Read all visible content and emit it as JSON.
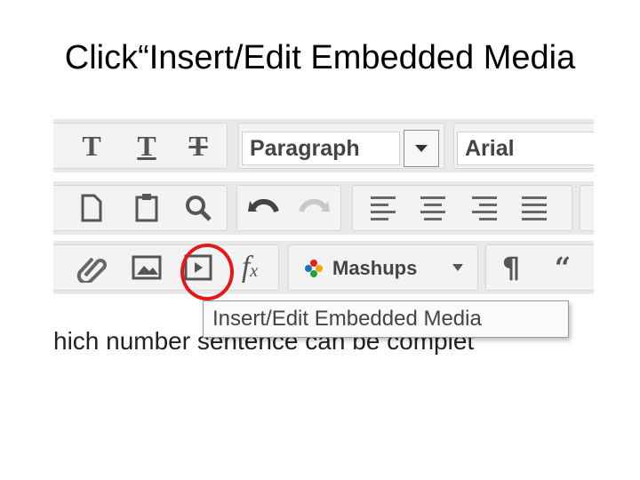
{
  "slide": {
    "title": "Click“Insert/Edit Embedded Media"
  },
  "editor": {
    "format_select": {
      "value": "Paragraph"
    },
    "font_select": {
      "value": "Arial"
    },
    "mashups_label": "Mashups",
    "tooltip": "Insert/Edit Embedded Media",
    "content_text": "hich number sentence can be complet",
    "colors": {
      "highlight": "#e01b1b",
      "toolbar_bg": "#e9e9e9"
    }
  }
}
